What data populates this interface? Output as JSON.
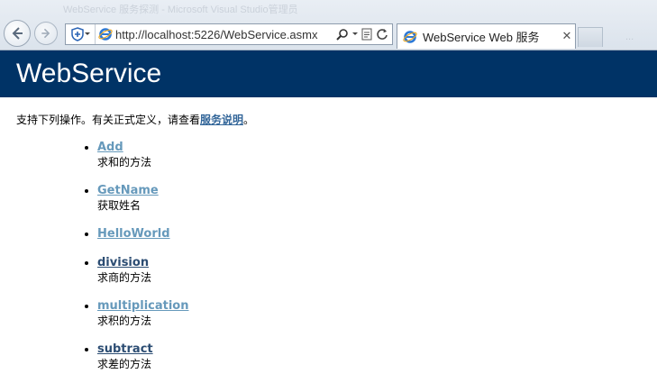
{
  "browser": {
    "ghost_title": "WebService 服务探测 - Microsoft Visual Studio管理员",
    "url": "http://localhost:5226/WebService.asmx",
    "tab_title": "WebService Web 服务",
    "tab_close": "✕",
    "ghost_right": "..."
  },
  "page": {
    "banner_title": "WebService",
    "intro_prefix": "支持下列操作。有关正式定义，请查看",
    "intro_link": "服务说明",
    "intro_suffix": "。",
    "operations": [
      {
        "name": "Add",
        "desc": "求和的方法",
        "style": "visited"
      },
      {
        "name": "GetName",
        "desc": "获取姓名",
        "style": "visited"
      },
      {
        "name": "HelloWorld",
        "desc": "",
        "style": "visited"
      },
      {
        "name": "division",
        "desc": "求商的方法",
        "style": "unvisited"
      },
      {
        "name": "multiplication",
        "desc": "求积的方法",
        "style": "visited"
      },
      {
        "name": "subtract",
        "desc": "求差的方法",
        "style": "unvisited"
      }
    ]
  },
  "colors": {
    "banner": "#003366",
    "link_visited": "#6699bb",
    "link_unvisited": "#2c4d73"
  }
}
